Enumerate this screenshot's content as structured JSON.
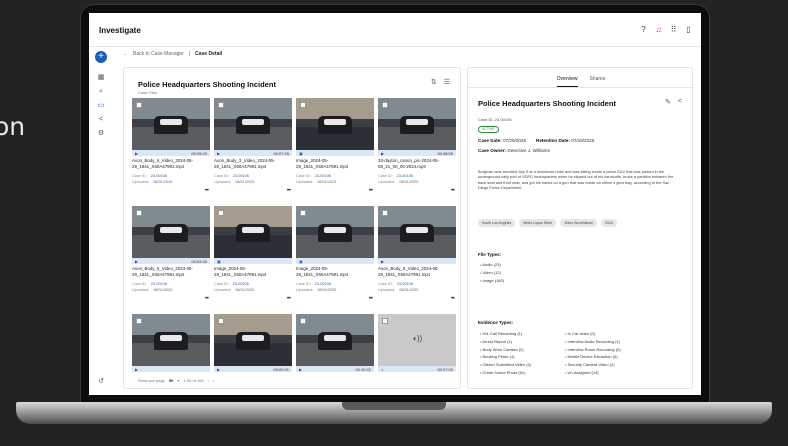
{
  "background_text": "on",
  "app": {
    "title": "Investigate"
  },
  "breadcrumb": {
    "back_label": "Back to Case Manager",
    "current": "Case Detail"
  },
  "case": {
    "title": "Police Headquarters Shooting Incident",
    "subtitle": "Case Files",
    "cards": [
      {
        "name": "Axon_Body_6_Video_2024-05-29_1841_X60A47991.mp4",
        "case_label": "Case ID:",
        "case_id": "23-00106",
        "upl_label": "Uploaded:",
        "uploaded": "08/01/2025",
        "duration": "00:05:00",
        "kind": "video",
        "thumb": "night"
      },
      {
        "name": "Axon_Body_3_Video_2024-05-29_1841_X60A47991.mp4",
        "case_label": "Case ID:",
        "case_id": "23-00106",
        "upl_label": "Uploaded:",
        "uploaded": "08/01/2025",
        "duration": "00:07:45",
        "kind": "video",
        "thumb": "night"
      },
      {
        "name": "Image_2024-05-29_1841_X60A47991.mp4",
        "case_label": "Case ID:",
        "case_id": "23-00106",
        "upl_label": "Uploaded:",
        "uploaded": "08/01/2025",
        "duration": "",
        "kind": "image",
        "thumb": "day"
      },
      {
        "name": "33-dayton_canon_pic-2024-05-08_21_00_00-2024.mp4",
        "case_label": "Case ID:",
        "case_id": "23-00106",
        "upl_label": "Uploaded:",
        "uploaded": "08/01/2025",
        "duration": "00:08:55",
        "kind": "video",
        "thumb": "night"
      },
      {
        "name": "Axon_Body_6_Video_2024-05-29_1841_X60A47991.mp4",
        "case_label": "Case ID:",
        "case_id": "23-00106",
        "upl_label": "Uploaded:",
        "uploaded": "08/01/2025",
        "duration": "00:03:30",
        "kind": "video",
        "thumb": "night"
      },
      {
        "name": "Image_2024-05-29_1841_X60A47991.mp4",
        "case_label": "Case ID:",
        "case_id": "23-00106",
        "upl_label": "Uploaded:",
        "uploaded": "08/01/2025",
        "duration": "",
        "kind": "image",
        "thumb": "day"
      },
      {
        "name": "Image_2024-05-29_1841_X60A47991.mp4",
        "case_label": "Case ID:",
        "case_id": "23-00106",
        "upl_label": "Uploaded:",
        "uploaded": "08/01/2025",
        "duration": "",
        "kind": "image",
        "thumb": "night"
      },
      {
        "name": "Axon_Body_5_Video_2024-05-29_1841_X60A47991.mp4",
        "case_label": "Case ID:",
        "case_id": "23-00106",
        "upl_label": "Uploaded:",
        "uploaded": "08/01/2025",
        "duration": "",
        "kind": "video",
        "thumb": "night"
      },
      {
        "name": "",
        "case_label": "",
        "case_id": "",
        "upl_label": "",
        "uploaded": "",
        "duration": "",
        "kind": "video",
        "thumb": "night"
      },
      {
        "name": "",
        "case_label": "",
        "case_id": "",
        "upl_label": "",
        "uploaded": "",
        "duration": "00:09:31",
        "kind": "video",
        "thumb": "day"
      },
      {
        "name": "",
        "case_label": "",
        "case_id": "",
        "upl_label": "",
        "uploaded": "",
        "duration": "00:10:42",
        "kind": "video",
        "thumb": "night"
      },
      {
        "name": "",
        "case_label": "",
        "case_id": "",
        "upl_label": "",
        "uploaded": "",
        "duration": "00:07:00",
        "kind": "audio",
        "thumb": "grey"
      }
    ],
    "pager": {
      "rows_label": "Rows per page",
      "rows_value": "50",
      "range": "1-50 of 193"
    }
  },
  "detail": {
    "tabs": [
      "Overview",
      "Shares"
    ],
    "title": "Police Headquarters Shooting Incident",
    "case_id": "Case ID: 23-00106",
    "status": "ACTIVE",
    "case_date_label": "Case Date:",
    "case_date": "07/29/2025",
    "retention_label": "Retention Date:",
    "retention_date": "07/28/2026",
    "owner_label": "Case Owner:",
    "owner": "Detective J. Williams",
    "description": "Borginan was arrested July 5 at a downtown hotel and was sitting inside a patrol SUV that was parked in the underground sally port of SDPD headquarters when he slipped out of his handcuffs, broke a partition between the back seat and front seat, and got his hands on a gun that was inside an officer's gear bag, according to the San Diego Police Department.",
    "tags": [
      "South Los Angeles",
      "Metro Liquor Store",
      "Video Surveillance",
      "2024"
    ],
    "file_types_label": "File Types:",
    "file_types": [
      "Audio (23)",
      "Video (12)",
      "Image (180)"
    ],
    "evidence_label": "Evidence Types:",
    "evidence_left": [
      "911 Call Recording (1)",
      "Arrest Report (1)",
      "Body Worn Camera (2)",
      "Booking Photo (4)",
      "Citizen Submitted Video (0)",
      "Crime Scene Photo (51)"
    ],
    "evidence_right": [
      "In Car video (0)",
      "Interview Audio Recording (1)",
      "Interview Room Recording (0)",
      "Mobile Device Extraction (0)",
      "Security Camera Video (2)",
      "Un-Assigned (14)"
    ]
  }
}
